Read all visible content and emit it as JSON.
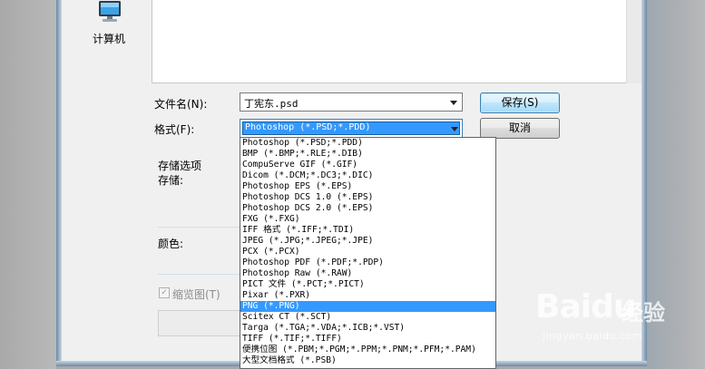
{
  "places": {
    "computer_label": "计算机"
  },
  "form": {
    "filename_label": "文件名(N):",
    "filename_value": "丁宪东.psd",
    "format_label": "格式(F):",
    "format_value": "Photoshop (*.PSD;*.PDD)"
  },
  "buttons": {
    "save": "保存(S)",
    "cancel": "取消"
  },
  "options": {
    "section_title": "存储选项",
    "storage_label": "存储:",
    "color_label": "颜色:",
    "thumbnail_label": "缩览图(T)",
    "thumbnail_checked": true
  },
  "format_list": [
    "Photoshop (*.PSD;*.PDD)",
    "BMP (*.BMP;*.RLE;*.DIB)",
    "CompuServe GIF (*.GIF)",
    "Dicom (*.DCM;*.DC3;*.DIC)",
    "Photoshop EPS (*.EPS)",
    "Photoshop DCS 1.0 (*.EPS)",
    "Photoshop DCS 2.0 (*.EPS)",
    "FXG (*.FXG)",
    "IFF 格式 (*.IFF;*.TDI)",
    "JPEG (*.JPG;*.JPEG;*.JPE)",
    "PCX (*.PCX)",
    "Photoshop PDF (*.PDF;*.PDP)",
    "Photoshop Raw (*.RAW)",
    "PICT 文件 (*.PCT;*.PICT)",
    "Pixar (*.PXR)",
    "PNG (*.PNG)",
    "Scitex CT (*.SCT)",
    "Targa (*.TGA;*.VDA;*.ICB;*.VST)",
    "TIFF (*.TIF;*.TIFF)",
    "便携位图 (*.PBM;*.PGM;*.PPM;*.PNM;*.PFM;*.PAM)",
    "大型文档格式 (*.PSB)"
  ],
  "selected_format_index": 15,
  "watermark": {
    "brand": "Baidu",
    "suffix": "经验",
    "url": "jingyan.baidu.com"
  },
  "colors": {
    "selection": "#3399ff",
    "dialog_bg": "#f0f0f0"
  }
}
